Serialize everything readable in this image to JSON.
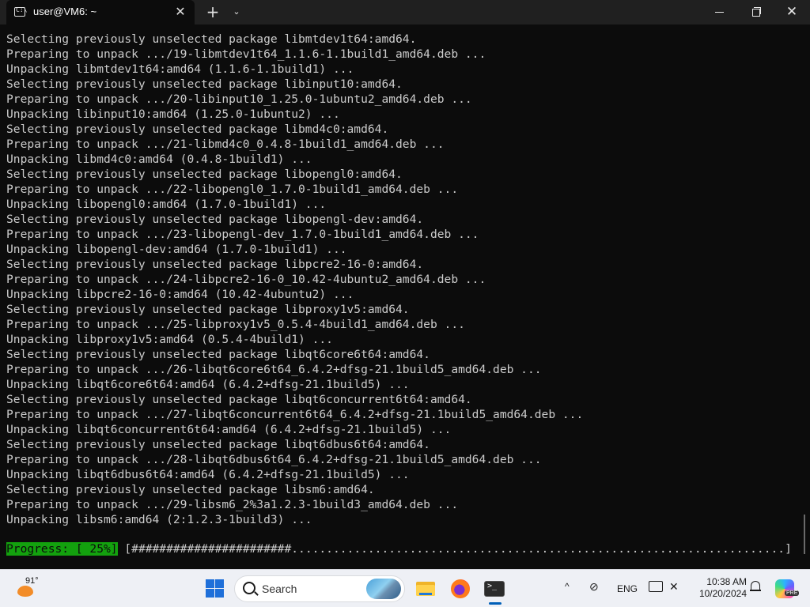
{
  "window": {
    "tab_title": "user@VM6: ~",
    "tab_close_glyph": "✕",
    "new_tab_glyph": "+",
    "dropdown_glyph": "⌄",
    "close_glyph": "✕"
  },
  "terminal": {
    "lines": [
      "Selecting previously unselected package libmtdev1t64:amd64.",
      "Preparing to unpack .../19-libmtdev1t64_1.1.6-1.1build1_amd64.deb ...",
      "Unpacking libmtdev1t64:amd64 (1.1.6-1.1build1) ...",
      "Selecting previously unselected package libinput10:amd64.",
      "Preparing to unpack .../20-libinput10_1.25.0-1ubuntu2_amd64.deb ...",
      "Unpacking libinput10:amd64 (1.25.0-1ubuntu2) ...",
      "Selecting previously unselected package libmd4c0:amd64.",
      "Preparing to unpack .../21-libmd4c0_0.4.8-1build1_amd64.deb ...",
      "Unpacking libmd4c0:amd64 (0.4.8-1build1) ...",
      "Selecting previously unselected package libopengl0:amd64.",
      "Preparing to unpack .../22-libopengl0_1.7.0-1build1_amd64.deb ...",
      "Unpacking libopengl0:amd64 (1.7.0-1build1) ...",
      "Selecting previously unselected package libopengl-dev:amd64.",
      "Preparing to unpack .../23-libopengl-dev_1.7.0-1build1_amd64.deb ...",
      "Unpacking libopengl-dev:amd64 (1.7.0-1build1) ...",
      "Selecting previously unselected package libpcre2-16-0:amd64.",
      "Preparing to unpack .../24-libpcre2-16-0_10.42-4ubuntu2_amd64.deb ...",
      "Unpacking libpcre2-16-0:amd64 (10.42-4ubuntu2) ...",
      "Selecting previously unselected package libproxy1v5:amd64.",
      "Preparing to unpack .../25-libproxy1v5_0.5.4-4build1_amd64.deb ...",
      "Unpacking libproxy1v5:amd64 (0.5.4-4build1) ...",
      "Selecting previously unselected package libqt6core6t64:amd64.",
      "Preparing to unpack .../26-libqt6core6t64_6.4.2+dfsg-21.1build5_amd64.deb ...",
      "Unpacking libqt6core6t64:amd64 (6.4.2+dfsg-21.1build5) ...",
      "Selecting previously unselected package libqt6concurrent6t64:amd64.",
      "Preparing to unpack .../27-libqt6concurrent6t64_6.4.2+dfsg-21.1build5_amd64.deb ...",
      "Unpacking libqt6concurrent6t64:amd64 (6.4.2+dfsg-21.1build5) ...",
      "Selecting previously unselected package libqt6dbus6t64:amd64.",
      "Preparing to unpack .../28-libqt6dbus6t64_6.4.2+dfsg-21.1build5_amd64.deb ...",
      "Unpacking libqt6dbus6t64:amd64 (6.4.2+dfsg-21.1build5) ...",
      "Selecting previously unselected package libsm6:amd64.",
      "Preparing to unpack .../29-libsm6_2%3a1.2.3-1build3_amd64.deb ...",
      "Unpacking libsm6:amd64 (2:1.2.3-1build3) ..."
    ],
    "progress": {
      "label": "Progress: [ 25%]",
      "bar": " [#######################.......................................................................]",
      "percent": 25
    },
    "colors": {
      "background": "#0c0c0c",
      "text": "#cccccc",
      "progress_bg": "#13a10e"
    }
  },
  "taskbar": {
    "weather_temp": "91°",
    "search_placeholder": "Search",
    "tray_lang": "ENG",
    "tray_chevron": "^",
    "clock_time": "10:38 AM",
    "clock_date": "10/20/2024",
    "copilot_badge": "PRE",
    "icons": [
      "weather-icon",
      "start-icon",
      "search-icon",
      "file-explorer-icon",
      "firefox-icon",
      "terminal-icon",
      "network-icon",
      "monitor-icon",
      "volume-icon",
      "bell-icon",
      "copilot-icon"
    ]
  }
}
